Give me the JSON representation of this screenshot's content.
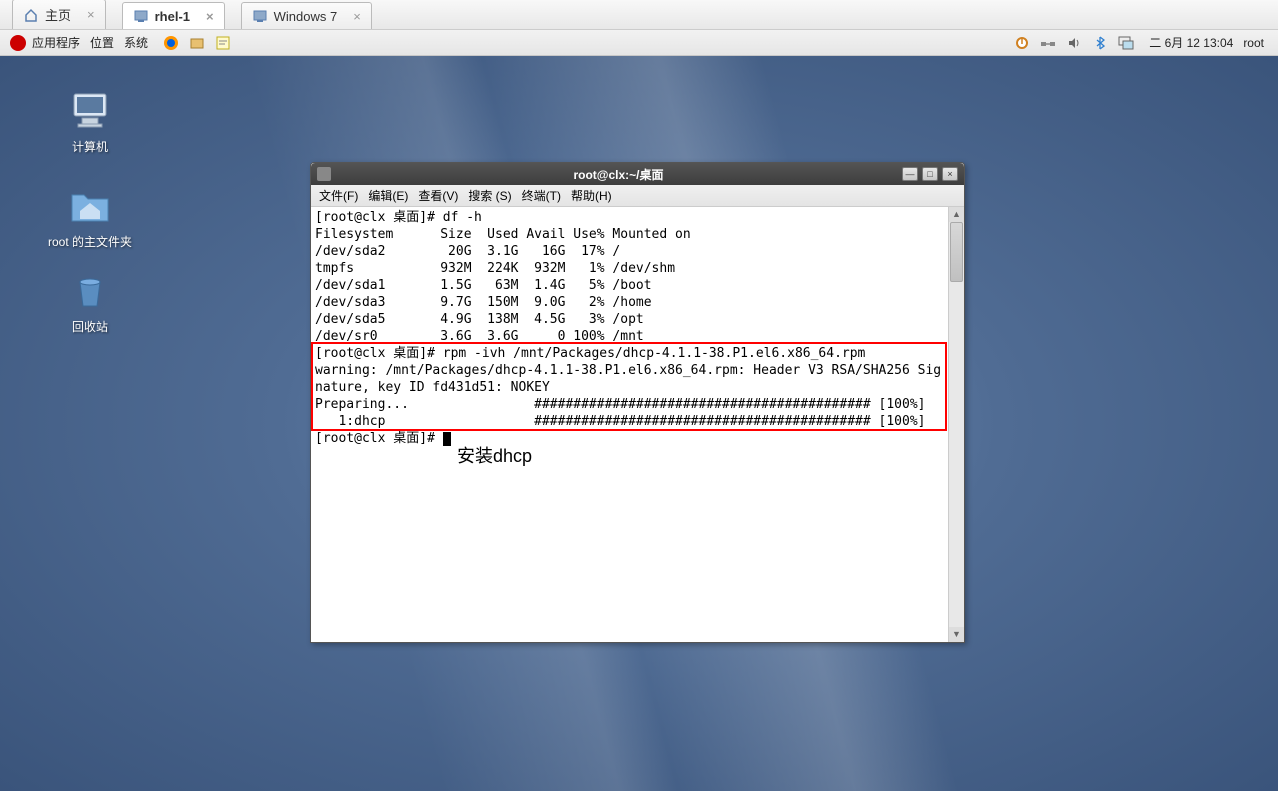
{
  "vm_tabs": {
    "home": "主页",
    "rhel": "rhel-1",
    "win": "Windows 7"
  },
  "gnome_panel": {
    "apps": "应用程序",
    "places": "位置",
    "system": "系统",
    "clock": "二 6月 12 13:04",
    "user": "root"
  },
  "desktop": {
    "computer": "计算机",
    "home": "root 的主文件夹",
    "trash": "回收站"
  },
  "terminal": {
    "title": "root@clx:~/桌面",
    "menu": {
      "file": "文件(F)",
      "edit": "编辑(E)",
      "view": "查看(V)",
      "search": "搜索 (S)",
      "terminal": "终端(T)",
      "help": "帮助(H)"
    },
    "lines": {
      "l0": "[root@clx 桌面]# df -h",
      "l1": "Filesystem      Size  Used Avail Use% Mounted on",
      "l2": "/dev/sda2        20G  3.1G   16G  17% /",
      "l3": "tmpfs           932M  224K  932M   1% /dev/shm",
      "l4": "/dev/sda1       1.5G   63M  1.4G   5% /boot",
      "l5": "/dev/sda3       9.7G  150M  9.0G   2% /home",
      "l6": "/dev/sda5       4.9G  138M  4.5G   3% /opt",
      "l7": "/dev/sr0        3.6G  3.6G     0 100% /mnt",
      "l8": "[root@clx 桌面]# rpm -ivh /mnt/Packages/dhcp-4.1.1-38.P1.el6.x86_64.rpm",
      "l9": "warning: /mnt/Packages/dhcp-4.1.1-38.P1.el6.x86_64.rpm: Header V3 RSA/SHA256 Sig",
      "l10": "nature, key ID fd431d51: NOKEY",
      "l11": "Preparing...                ########################################### [100%]",
      "l12": "   1:dhcp                   ########################################### [100%]",
      "l13": "[root@clx 桌面]# "
    }
  },
  "annotation": "安装dhcp"
}
